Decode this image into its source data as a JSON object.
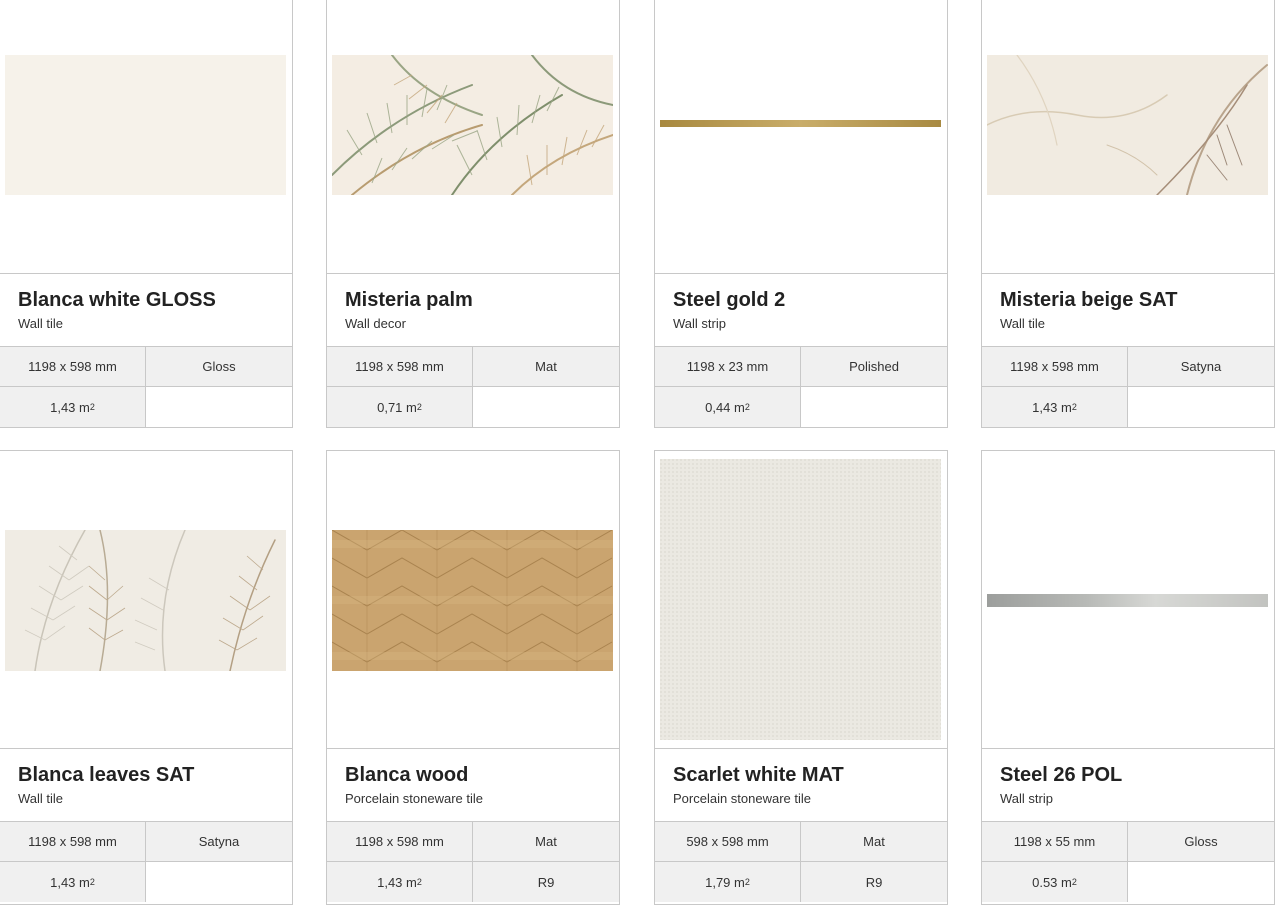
{
  "products": [
    {
      "title": "Blanca white GLOSS",
      "type": "Wall tile",
      "size": "1198 x 598 mm",
      "finish": "Gloss",
      "area": "1,43 m",
      "area_unit_exp": "2",
      "slip": "",
      "image": "plain-cream-tile"
    },
    {
      "title": "Misteria palm",
      "type": "Wall decor",
      "size": "1198 x 598 mm",
      "finish": "Mat",
      "area": "0,71 m",
      "area_unit_exp": "2",
      "slip": "",
      "image": "palm-leaves-decor"
    },
    {
      "title": "Steel gold 2",
      "type": "Wall strip",
      "size": "1198 x 23 mm",
      "finish": "Polished",
      "area": "0,44 m",
      "area_unit_exp": "2",
      "slip": "",
      "image": "gold-strip"
    },
    {
      "title": "Misteria beige SAT",
      "type": "Wall tile",
      "size": "1198 x 598 mm",
      "finish": "Satyna",
      "area": "1,43 m",
      "area_unit_exp": "2",
      "slip": "",
      "image": "beige-marble-tile"
    },
    {
      "title": "Blanca leaves SAT",
      "type": "Wall tile",
      "size": "1198 x 598 mm",
      "finish": "Satyna",
      "area": "1,43 m",
      "area_unit_exp": "2",
      "slip": "",
      "image": "feather-leaves-tile"
    },
    {
      "title": "Blanca wood",
      "type": "Porcelain stoneware tile",
      "size": "1198 x 598 mm",
      "finish": "Mat",
      "area": "1,43 m",
      "area_unit_exp": "2",
      "slip": "R9",
      "image": "herringbone-wood-tile"
    },
    {
      "title": "Scarlet white MAT",
      "type": "Porcelain stoneware tile",
      "size": "598 x 598 mm",
      "finish": "Mat",
      "area": "1,79 m",
      "area_unit_exp": "2",
      "slip": "R9",
      "image": "white-textured-square-tile"
    },
    {
      "title": "Steel 26 POL",
      "type": "Wall strip",
      "size": "1198 x 55 mm",
      "finish": "Gloss",
      "area": "0.53 m",
      "area_unit_exp": "2",
      "slip": "",
      "image": "silver-strip"
    }
  ]
}
